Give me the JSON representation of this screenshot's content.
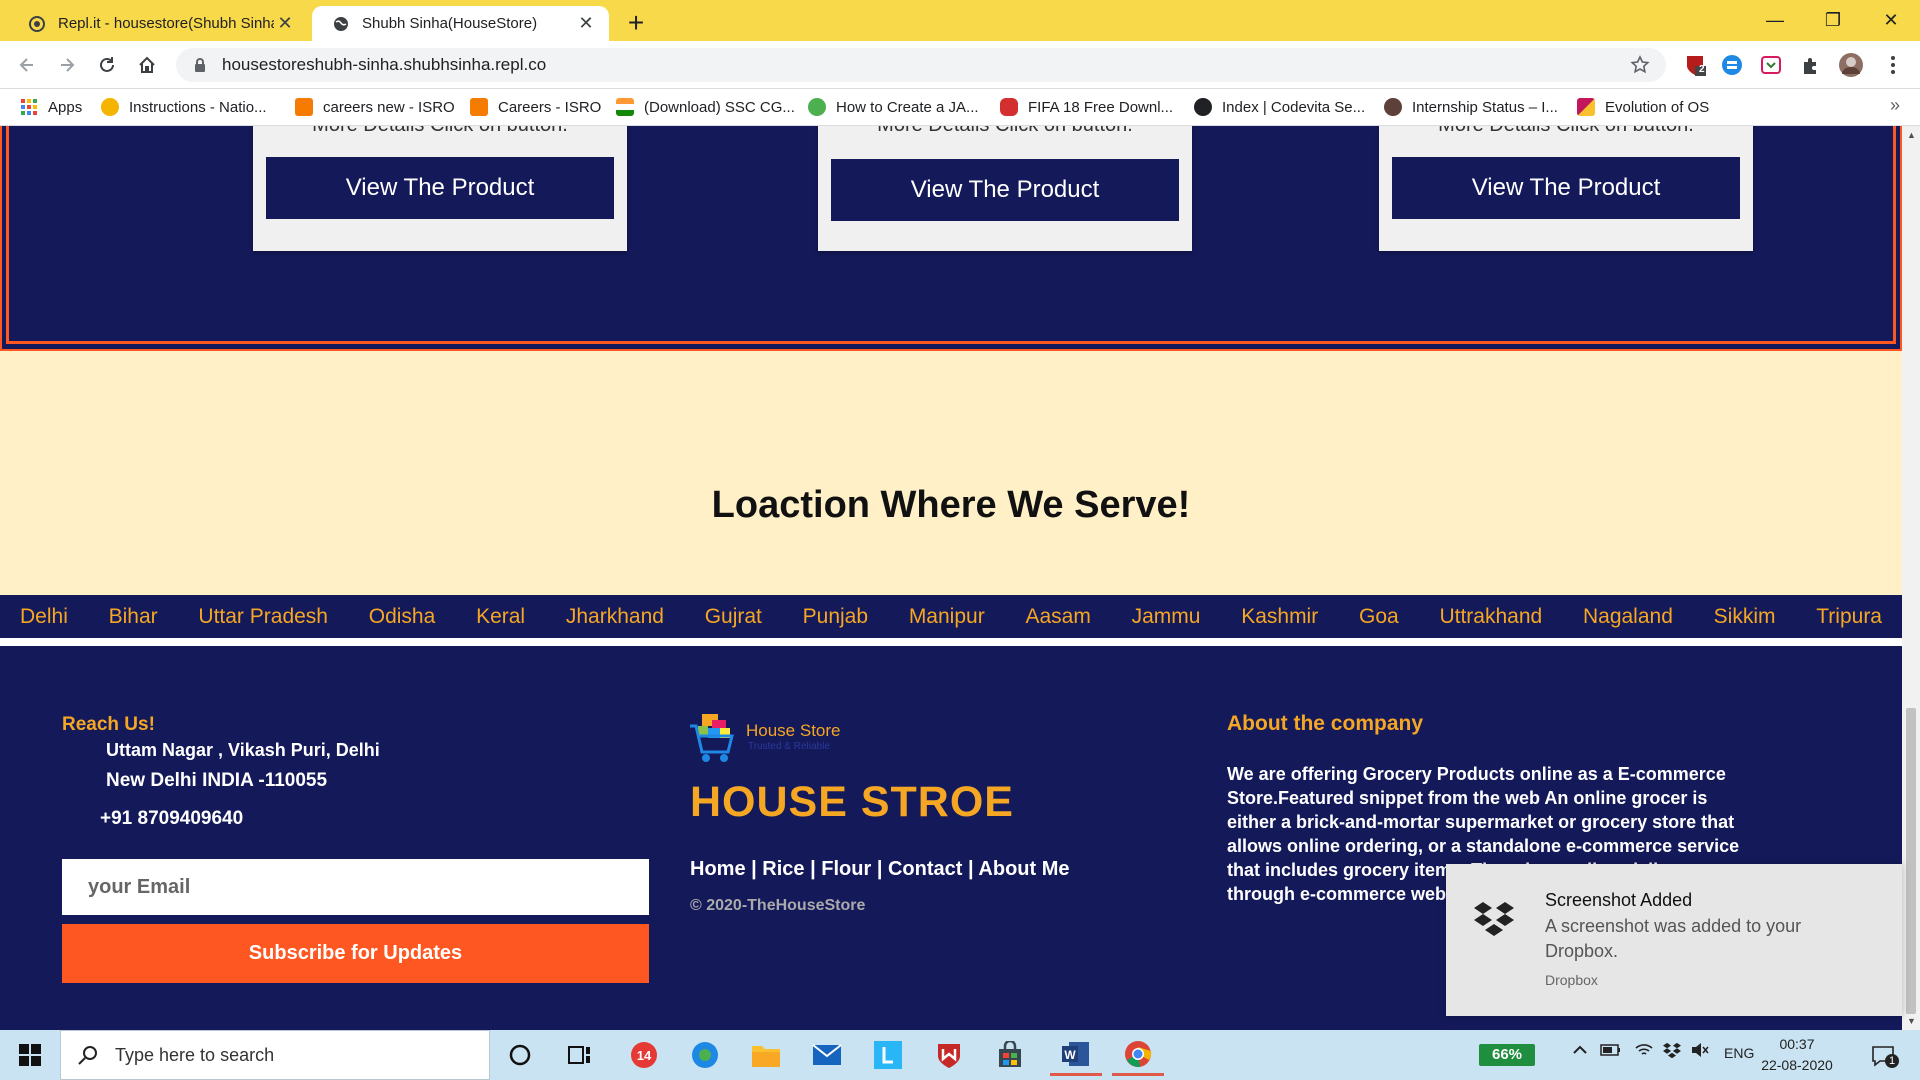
{
  "browser": {
    "tabs": [
      {
        "title": "Repl.it - housestore(Shubh Sinha)",
        "close": "✕",
        "active": false
      },
      {
        "title": "Shubh Sinha(HouseStore)",
        "close": "✕",
        "active": true
      }
    ],
    "new_tab": "+",
    "window_controls": {
      "minimize": "—",
      "restore": "❐",
      "close": "✕"
    },
    "url": "housestoreshubh-sinha.shubhsinha.repl.co",
    "extension_badge": "2",
    "bookmarks": [
      {
        "label": "Apps",
        "icon": "apps-grid-icon",
        "color": "#ea4335"
      },
      {
        "label": "Instructions - Natio...",
        "icon": "lightbulb-icon",
        "color": "#f4b400"
      },
      {
        "label": "careers new - ISRO",
        "icon": "isro-icon",
        "color": "#f57c00"
      },
      {
        "label": "Careers - ISRO",
        "icon": "isro-icon",
        "color": "#f57c00"
      },
      {
        "label": "(Download) SSC CG...",
        "icon": "india-flag-icon",
        "color": "#ff9933"
      },
      {
        "label": "How to Create a JA...",
        "icon": "site-icon",
        "color": "#4caf50"
      },
      {
        "label": "FIFA 18 Free Downl...",
        "icon": "gamepad-icon",
        "color": "#d32f2f"
      },
      {
        "label": "Index | Codevita Se...",
        "icon": "globe-icon",
        "color": "#202124"
      },
      {
        "label": "Internship Status – I...",
        "icon": "site-icon",
        "color": "#5d4037"
      },
      {
        "label": "Evolution of OS",
        "icon": "site-icon",
        "color": "#c2185b"
      }
    ],
    "more_bookmarks": "»"
  },
  "products": {
    "cards": [
      {
        "partial_text": "More Details Click on button.",
        "button_label": "View The Product"
      },
      {
        "partial_text": "More Details Click on button.",
        "button_label": "View The Product"
      },
      {
        "partial_text": "More Details Click on button.",
        "button_label": "View The Product"
      }
    ]
  },
  "location": {
    "heading": "Loaction Where We Serve!",
    "states": [
      "Delhi",
      "Bihar",
      "Uttar Pradesh",
      "Odisha",
      "Keral",
      "Jharkhand",
      "Gujrat",
      "Punjab",
      "Manipur",
      "Aasam",
      "Jammu",
      "Kashmir",
      "Goa",
      "Uttrakhand",
      "Nagaland",
      "Sikkim",
      "Tripura"
    ]
  },
  "footer": {
    "reach_heading": "Reach Us!",
    "address_line1": "Uttam Nagar , Vikash Puri, Delhi",
    "address_line2": "New Delhi INDIA -110055",
    "phone": "+91 8709409640",
    "email_placeholder": "your Email",
    "subscribe_label": "Subscribe for Updates",
    "logo_name": "House Store",
    "logo_tagline": "Trusted & Reliable",
    "brand": "HOUSE STROE",
    "links": [
      "Home",
      "Rice",
      "Flour",
      "Contact",
      "About Me"
    ],
    "link_separator": " | ",
    "copyright": "© 2020-TheHouseStore",
    "about_heading": "About the company",
    "about_text": "We are offering Grocery Products online as a E-commerce Store.Featured snippet from the web An online grocer is either a brick-and-mortar supermarket or grocery store that allows online ordering, or a standalone e-commerce service that includes grocery items. There is usually a delivery through e-commerce website."
  },
  "notification": {
    "title": "Screenshot Added",
    "body": "A screenshot was added to your Dropbox.",
    "source": "Dropbox"
  },
  "taskbar": {
    "search_placeholder": "Type here to search",
    "battery": "66%",
    "language": "ENG",
    "time": "00:37",
    "date": "22-08-2020",
    "notification_count": "1"
  },
  "colors": {
    "navy": "#14195a",
    "orange": "#ff5722",
    "gold": "#f5a623",
    "cream": "#fff0c8",
    "chrome_yellow": "#f8d94a"
  }
}
